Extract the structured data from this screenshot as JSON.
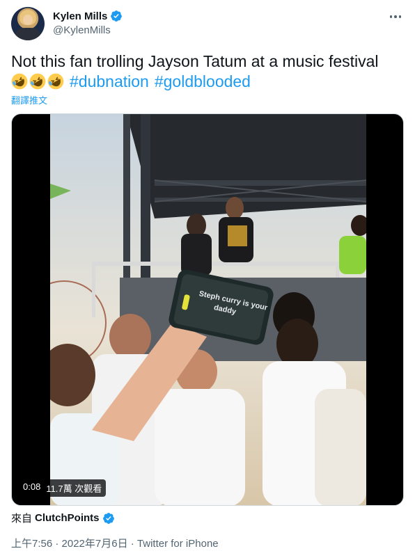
{
  "author": {
    "display_name": "Kylen Mills",
    "handle": "@KylenMills",
    "verified_icon": "verified-badge-icon"
  },
  "tweet": {
    "text": "Not this fan trolling Jayson Tatum at a music festival",
    "emoji": [
      "rolling-on-floor-laughing-icon",
      "rolling-on-floor-laughing-icon",
      "rolling-on-floor-laughing-icon"
    ],
    "hashtags": [
      "#dubnation",
      "#goldblooded"
    ],
    "translate_label": "翻譯推文"
  },
  "media": {
    "elapsed": "0:08",
    "views": "11.7萬 次觀看",
    "phone_text_line1": "Steph curry is your",
    "phone_text_line2": "daddy"
  },
  "source": {
    "prefix": "來自",
    "name": "ClutchPoints"
  },
  "meta": {
    "time": "上午7:56",
    "date": "2022年7月6日",
    "client": "Twitter for iPhone",
    "line": "上午7:56 · 2022年7月6日 · Twitter for iPhone"
  },
  "colors": {
    "link": "#1d9bf0",
    "text": "#0f1419",
    "secondary": "#536471"
  }
}
